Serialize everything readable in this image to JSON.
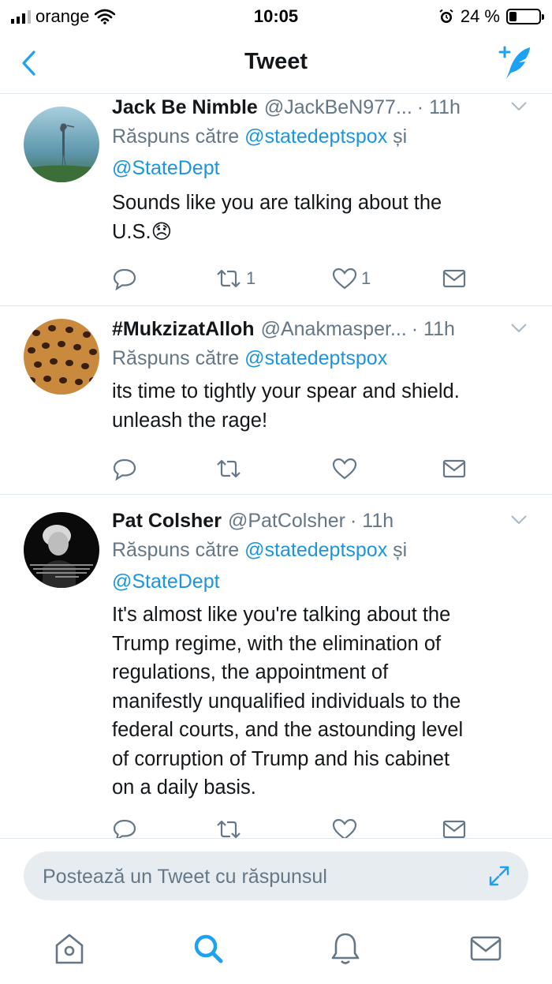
{
  "status_bar": {
    "carrier": "orange",
    "time": "10:05",
    "battery_percent": "24 %",
    "battery_level": 0.24
  },
  "nav": {
    "title": "Tweet"
  },
  "colors": {
    "accent": "#1da1f2",
    "mention": "#1b95e0",
    "muted": "#657786"
  },
  "tweets": [
    {
      "name": "Jack Be Nimble",
      "handle": "@JackBeN977...",
      "time": "· 11h",
      "reply_prefix": "Răspuns către",
      "reply_mention_1": "@statedeptspox",
      "reply_joiner": "și",
      "reply_mention_2": "@StateDept",
      "text_line_1": "Sounds like you are talking about the",
      "text_line_2": "U.S.",
      "emoji": "😞",
      "retweets": "1",
      "likes": "1"
    },
    {
      "name": "#MukzizatAlloh",
      "handle": "@Anakmasper...",
      "time": "· 11h",
      "reply_prefix": "Răspuns către",
      "reply_mention_1": "@statedeptspox",
      "text_line_1": "its time to tightly your spear and shield.",
      "text_line_2": "unleash the rage!",
      "retweets": "",
      "likes": ""
    },
    {
      "name": "Pat Colsher",
      "handle": "@PatColsher",
      "time": "· 11h",
      "reply_prefix": "Răspuns către",
      "reply_mention_1": "@statedeptspox",
      "reply_joiner": "și",
      "reply_mention_2": "@StateDept",
      "text_lines": [
        "It's almost like you're talking about the",
        "Trump regime, with the elimination of",
        "regulations, the appointment of",
        "manifestly unqualified individuals to the",
        "federal courts, and the astounding level",
        "of corruption of Trump and his cabinet",
        "on a daily basis."
      ]
    }
  ],
  "reply_bar": {
    "placeholder": "Postează un Tweet cu răspunsul"
  },
  "tab_bar": {
    "items": [
      "home-icon",
      "search-icon",
      "notifications-icon",
      "messages-icon"
    ]
  }
}
